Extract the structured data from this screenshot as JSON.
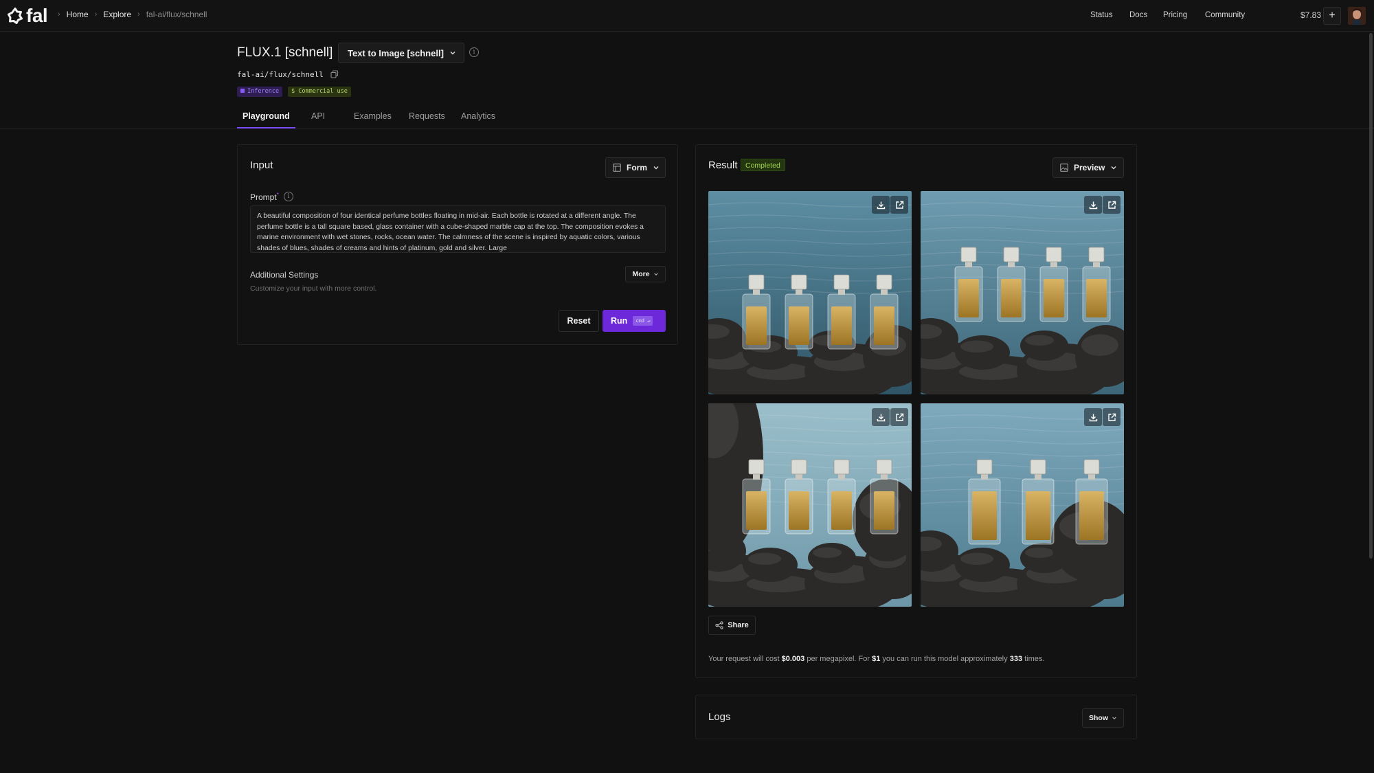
{
  "nav": {
    "logo": "fal",
    "breadcrumbs": [
      "Home",
      "Explore",
      "fal-ai/flux/schnell"
    ],
    "links": [
      "Status",
      "Docs",
      "Pricing",
      "Community"
    ],
    "credits": "$7.83",
    "add_icon": "plus-icon"
  },
  "model": {
    "title": "FLUX.1 [schnell]",
    "endpoint": "Text to Image [schnell]",
    "id": "fal-ai/flux/schnell",
    "badges": [
      "Inference",
      "$ Commercial use"
    ]
  },
  "tabs": [
    "Playground",
    "API",
    "Examples",
    "Requests",
    "Analytics"
  ],
  "input": {
    "title": "Input",
    "view_mode": "Form",
    "prompt_label": "Prompt",
    "prompt_required_mark": "*",
    "prompt_value": "A beautiful composition of four identical perfume bottles floating in mid-air. Each bottle is rotated at a different angle. The perfume bottle is a tall square based, glass container with a cube-shaped marble cap at the top. The composition evokes a marine environment with wet stones, rocks, ocean water. The calmness of the scene is inspired by aquatic colors, various shades of blues, shades of creams and hints of platinum, gold and silver. Large",
    "additional_settings": "Additional Settings",
    "additional_hint": "Customize your input with more control.",
    "more_label": "More",
    "reset_label": "Reset",
    "run_label": "Run",
    "run_shortcut": "cmd",
    "run_shortcut_key": "↵"
  },
  "result": {
    "title": "Result",
    "status": "Completed",
    "view_mode": "Preview",
    "images": [
      {
        "alt": "Four perfume bottles on wet stones by the sea",
        "bottles": 4
      },
      {
        "alt": "Four perfume bottles with marble caps on dark rocks",
        "bottles": 4
      },
      {
        "alt": "Four perfume bottles over calm water beside rocks",
        "bottles": 4
      },
      {
        "alt": "Three perfume bottles floating over rocks and water",
        "bottles": 3
      }
    ],
    "share_label": "Share",
    "cost": {
      "prefix": "Your request will cost",
      "price": "$0.003",
      "mid1": "per megapixel. For",
      "budget": "$1",
      "mid2": "you can run this model approximately",
      "runs": "333",
      "suffix": "times."
    }
  },
  "logs": {
    "title": "Logs",
    "toggle": "Show"
  },
  "colors": {
    "accent": "#6d28d9",
    "background": "#111112",
    "success": "#9fd34f"
  }
}
